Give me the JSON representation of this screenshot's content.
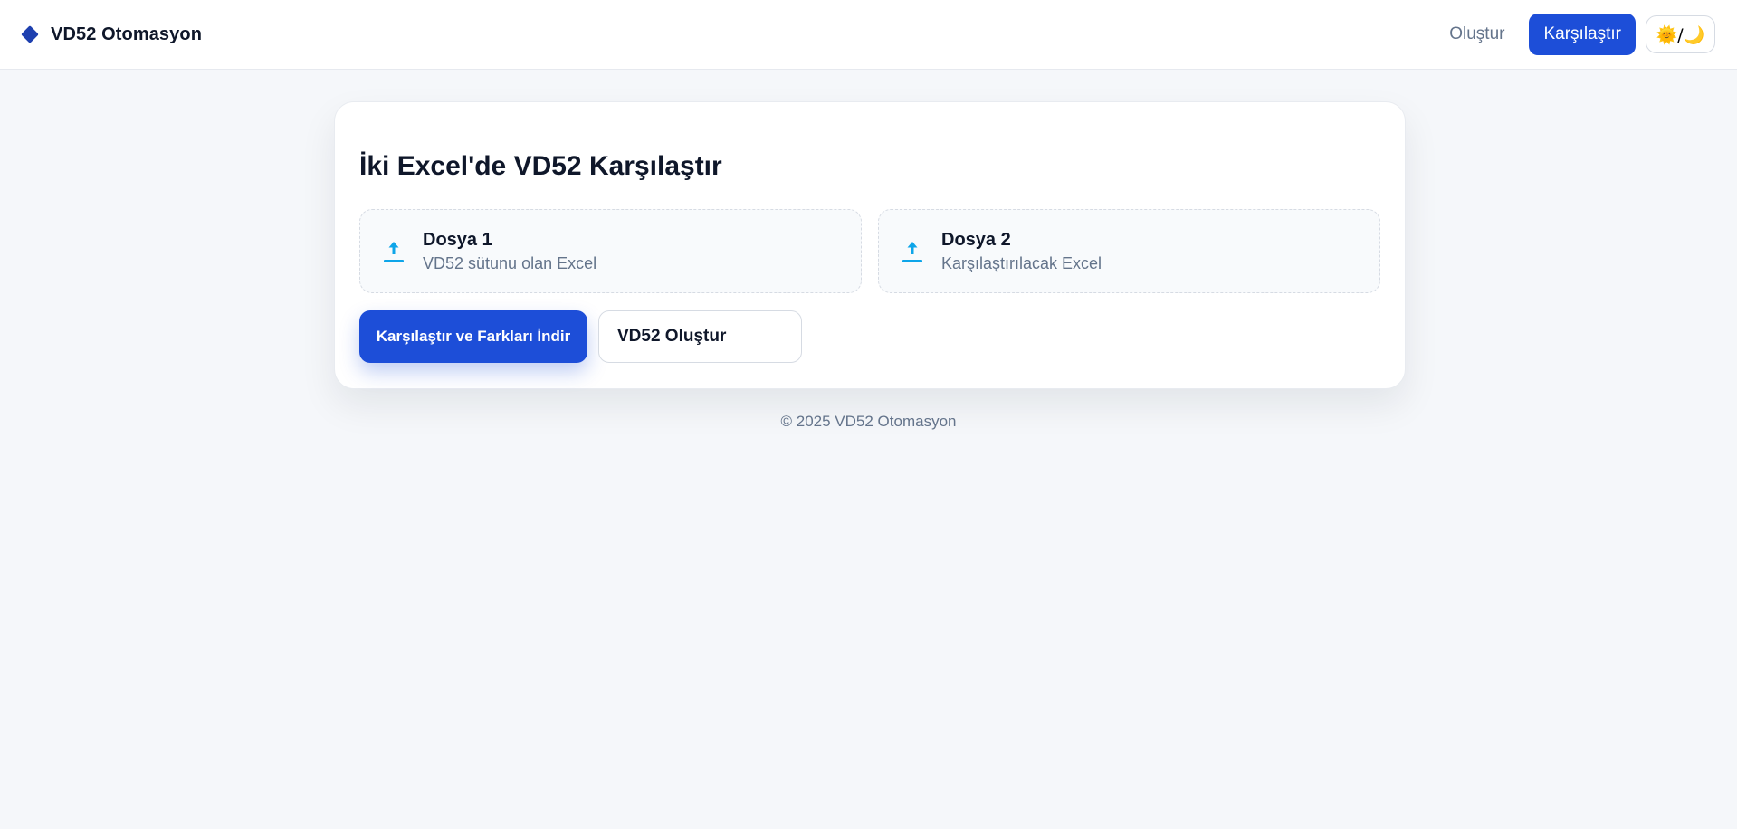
{
  "header": {
    "brand_icon": "diamond-icon",
    "brand_name": "VD52 Otomasyon",
    "nav": {
      "create_label": "Oluştur",
      "compare_label": "Karşılaştır",
      "theme_toggle_label": "🌞/🌙"
    }
  },
  "card": {
    "title": "İki Excel'de VD52 Karşılaştır",
    "file1": {
      "icon": "upload-icon",
      "title": "Dosya 1",
      "subtitle": "VD52 sütunu olan Excel"
    },
    "file2": {
      "icon": "upload-icon",
      "title": "Dosya 2",
      "subtitle": "Karşılaştırılacak Excel"
    },
    "primary_button": "Karşılaştır ve Farkları İndir",
    "secondary_button": "VD52 Oluştur"
  },
  "footer": {
    "text": "© 2025 VD52 Otomasyon"
  },
  "colors": {
    "accent": "#1d4ed8",
    "upload_icon": "#0ea5e9",
    "background": "#f5f7fa"
  }
}
